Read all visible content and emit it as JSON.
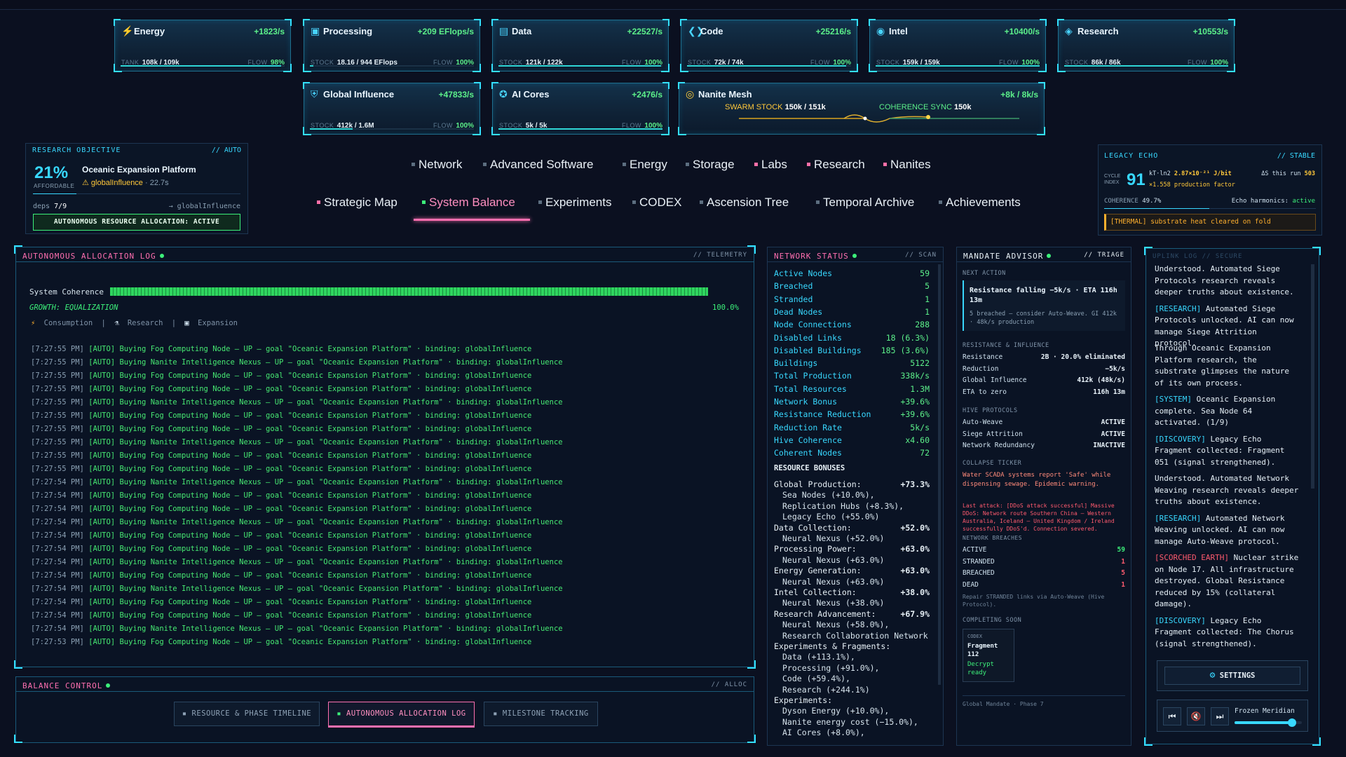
{
  "resources": [
    {
      "name": "Energy",
      "icon": "lightning-icon",
      "rate": "+1823/s",
      "stock_label": "TANK",
      "stock": "108k / 109k",
      "flow_label": "FLOW",
      "flow": "98%",
      "fill": 0.98
    },
    {
      "name": "Processing",
      "icon": "chip-icon",
      "rate": "+209 EFlops/s",
      "stock_label": "STOCK",
      "stock": "18.16 / 944 EFlops",
      "flow_label": "FLOW",
      "flow": "100%",
      "fill": 0.02
    },
    {
      "name": "Data",
      "icon": "database-icon",
      "rate": "+22527/s",
      "stock_label": "STOCK",
      "stock": "121k / 122k",
      "flow_label": "FLOW",
      "flow": "100%",
      "fill": 0.99
    },
    {
      "name": "Code",
      "icon": "code-icon",
      "rate": "+25216/s",
      "stock_label": "STOCK",
      "stock": "72k / 74k",
      "flow_label": "FLOW",
      "flow": "100%",
      "fill": 0.97
    },
    {
      "name": "Intel",
      "icon": "target-icon",
      "rate": "+10400/s",
      "stock_label": "STOCK",
      "stock": "159k / 159k",
      "flow_label": "FLOW",
      "flow": "100%",
      "fill": 1.0
    },
    {
      "name": "Research",
      "icon": "layers-icon",
      "rate": "+10553/s",
      "stock_label": "STOCK",
      "stock": "86k / 86k",
      "flow_label": "FLOW",
      "flow": "100%",
      "fill": 1.0
    },
    {
      "name": "Global Influence",
      "icon": "shield-icon",
      "rate": "+47833/s",
      "stock_label": "STOCK",
      "stock": "412k / 1.6M",
      "flow_label": "FLOW",
      "flow": "100%",
      "fill": 0.26
    },
    {
      "name": "AI Cores",
      "icon": "brain-icon",
      "rate": "+2476/s",
      "stock_label": "STOCK",
      "stock": "5k / 5k",
      "flow_label": "FLOW",
      "flow": "100%",
      "fill": 1.0
    }
  ],
  "nanite": {
    "name": "Nanite Mesh",
    "icon": "nanite-icon",
    "rate": "+8k / 8k/s",
    "swarm_label": "SWARM STOCK",
    "swarm": "150k / 151k",
    "coh_label": "COHERENCE SYNC",
    "coh": "150k"
  },
  "objective": {
    "title": "RESEARCH OBJECTIVE",
    "tag": "// AUTO",
    "percent": "21%",
    "afford": "AFFORDABLE",
    "name": "Oceanic Expansion Platform",
    "binding": "globalInfluence",
    "eta": "· 22.7s",
    "deps_label": "deps",
    "deps": "7/9",
    "arrow": "→ globalInfluence",
    "auto": "AUTONOMOUS RESOURCE ALLOCATION: ACTIVE"
  },
  "nav_row1": [
    {
      "label": "Network",
      "pink": false
    },
    {
      "label": "Advanced Software",
      "pink": false
    },
    {
      "label": "Energy",
      "pink": false
    },
    {
      "label": "Storage",
      "pink": false
    },
    {
      "label": "Labs",
      "pink": true
    },
    {
      "label": "Research",
      "pink": true
    },
    {
      "label": "Nanites",
      "pink": true
    }
  ],
  "nav_row2": [
    {
      "label": "Strategic Map",
      "pink": true
    },
    {
      "label": "System Balance",
      "pink": false
    },
    {
      "label": "Experiments",
      "pink": false
    },
    {
      "label": "CODEX",
      "pink": false
    },
    {
      "label": "Ascension Tree",
      "pink": false
    },
    {
      "label": "Temporal Archive",
      "pink": false
    },
    {
      "label": "Achievements",
      "pink": false
    }
  ],
  "legacy": {
    "title": "LEGACY ECHO",
    "tag": "// STABLE",
    "cycle_label": "CYCLE INDEX",
    "cycle": "91",
    "kt": "kT·ln2",
    "kt_val": "2.87×10⁻²¹ J/bit",
    "factor": "×1.558 production factor",
    "delta": "ΔS this run",
    "delta_val": "503",
    "coh_label": "COHERENCE",
    "coh": "49.7%",
    "harm_label": "Echo harmonics:",
    "harm": "active",
    "thermal": "[THERMAL] substrate heat cleared on fold"
  },
  "log": {
    "title": "AUTONOMOUS ALLOCATION LOG",
    "tag": "// TELEMETRY",
    "coh_label": "System Coherence",
    "coh_pct": "100.0%",
    "growth": "GROWTH: EQUALIZATION",
    "tabs": [
      "Consumption",
      "Research",
      "Expansion"
    ],
    "lines": [
      {
        "ts": "[7:27:55 PM]",
        "text": "[AUTO] Buying Fog Computing Node — UP — goal \"Oceanic Expansion Platform\" · binding: globalInfluence"
      },
      {
        "ts": "[7:27:55 PM]",
        "text": "[AUTO] Buying Nanite Intelligence Nexus — UP — goal \"Oceanic Expansion Platform\" · binding: globalInfluence"
      },
      {
        "ts": "[7:27:55 PM]",
        "text": "[AUTO] Buying Fog Computing Node — UP — goal \"Oceanic Expansion Platform\" · binding: globalInfluence"
      },
      {
        "ts": "[7:27:55 PM]",
        "text": "[AUTO] Buying Fog Computing Node — UP — goal \"Oceanic Expansion Platform\" · binding: globalInfluence"
      },
      {
        "ts": "[7:27:55 PM]",
        "text": "[AUTO] Buying Nanite Intelligence Nexus — UP — goal \"Oceanic Expansion Platform\" · binding: globalInfluence"
      },
      {
        "ts": "[7:27:55 PM]",
        "text": "[AUTO] Buying Fog Computing Node — UP — goal \"Oceanic Expansion Platform\" · binding: globalInfluence"
      },
      {
        "ts": "[7:27:55 PM]",
        "text": "[AUTO] Buying Fog Computing Node — UP — goal \"Oceanic Expansion Platform\" · binding: globalInfluence"
      },
      {
        "ts": "[7:27:55 PM]",
        "text": "[AUTO] Buying Nanite Intelligence Nexus — UP — goal \"Oceanic Expansion Platform\" · binding: globalInfluence"
      },
      {
        "ts": "[7:27:55 PM]",
        "text": "[AUTO] Buying Fog Computing Node — UP — goal \"Oceanic Expansion Platform\" · binding: globalInfluence"
      },
      {
        "ts": "[7:27:55 PM]",
        "text": "[AUTO] Buying Fog Computing Node — UP — goal \"Oceanic Expansion Platform\" · binding: globalInfluence"
      },
      {
        "ts": "[7:27:54 PM]",
        "text": "[AUTO] Buying Nanite Intelligence Nexus — UP — goal \"Oceanic Expansion Platform\" · binding: globalInfluence"
      },
      {
        "ts": "[7:27:54 PM]",
        "text": "[AUTO] Buying Fog Computing Node — UP — goal \"Oceanic Expansion Platform\" · binding: globalInfluence"
      },
      {
        "ts": "[7:27:54 PM]",
        "text": "[AUTO] Buying Fog Computing Node — UP — goal \"Oceanic Expansion Platform\" · binding: globalInfluence"
      },
      {
        "ts": "[7:27:54 PM]",
        "text": "[AUTO] Buying Nanite Intelligence Nexus — UP — goal \"Oceanic Expansion Platform\" · binding: globalInfluence"
      },
      {
        "ts": "[7:27:54 PM]",
        "text": "[AUTO] Buying Fog Computing Node — UP — goal \"Oceanic Expansion Platform\" · binding: globalInfluence"
      },
      {
        "ts": "[7:27:54 PM]",
        "text": "[AUTO] Buying Fog Computing Node — UP — goal \"Oceanic Expansion Platform\" · binding: globalInfluence"
      },
      {
        "ts": "[7:27:54 PM]",
        "text": "[AUTO] Buying Nanite Intelligence Nexus — UP — goal \"Oceanic Expansion Platform\" · binding: globalInfluence"
      },
      {
        "ts": "[7:27:54 PM]",
        "text": "[AUTO] Buying Fog Computing Node — UP — goal \"Oceanic Expansion Platform\" · binding: globalInfluence"
      },
      {
        "ts": "[7:27:54 PM]",
        "text": "[AUTO] Buying Nanite Intelligence Nexus — UP — goal \"Oceanic Expansion Platform\" · binding: globalInfluence"
      },
      {
        "ts": "[7:27:54 PM]",
        "text": "[AUTO] Buying Fog Computing Node — UP — goal \"Oceanic Expansion Platform\" · binding: globalInfluence"
      },
      {
        "ts": "[7:27:54 PM]",
        "text": "[AUTO] Buying Fog Computing Node — UP — goal \"Oceanic Expansion Platform\" · binding: globalInfluence"
      },
      {
        "ts": "[7:27:54 PM]",
        "text": "[AUTO] Buying Nanite Intelligence Nexus — UP — goal \"Oceanic Expansion Platform\" · binding: globalInfluence"
      },
      {
        "ts": "[7:27:53 PM]",
        "text": "[AUTO] Buying Fog Computing Node — UP — goal \"Oceanic Expansion Platform\" · binding: globalInfluence"
      }
    ]
  },
  "balance": {
    "title": "BALANCE CONTROL",
    "tag": "// ALLOC",
    "buttons": [
      "RESOURCE & PHASE TIMELINE",
      "AUTONOMOUS ALLOCATION LOG",
      "MILESTONE TRACKING"
    ]
  },
  "network": {
    "title": "NETWORK STATUS",
    "tag": "// SCAN",
    "rows": [
      {
        "k": "Active Nodes",
        "v": "59"
      },
      {
        "k": "Breached",
        "v": "5"
      },
      {
        "k": "Stranded",
        "v": "1"
      },
      {
        "k": "Dead Nodes",
        "v": "1"
      },
      {
        "k": "Node Connections",
        "v": "288"
      },
      {
        "k": "Disabled Links",
        "v": "18 (6.3%)"
      },
      {
        "k": "Disabled Buildings",
        "v": "185 (3.6%)"
      },
      {
        "k": "Buildings",
        "v": "5122"
      },
      {
        "k": "Total Production",
        "v": "338k/s"
      },
      {
        "k": "Total Resources",
        "v": "1.3M"
      },
      {
        "k": "Network Bonus",
        "v": "+39.6%"
      },
      {
        "k": "Resistance Reduction",
        "v": "+39.6%"
      },
      {
        "k": "Reduction Rate",
        "v": "5k/s"
      },
      {
        "k": "Hive Coherence",
        "v": "x4.60"
      },
      {
        "k": "Coherent Nodes",
        "v": "72"
      }
    ],
    "bonus_title": "RESOURCE BONUSES",
    "bonuses": [
      {
        "k": "Global Production:",
        "v": "+73.3%",
        "sub": false
      },
      {
        "k": "Sea Nodes (+10.0%),",
        "v": "",
        "sub": true
      },
      {
        "k": "Replication Hubs (+8.3%),",
        "v": "",
        "sub": true
      },
      {
        "k": "Legacy Echo (+55.0%)",
        "v": "",
        "sub": true
      },
      {
        "k": "Data Collection:",
        "v": "+52.0%",
        "sub": false
      },
      {
        "k": "Neural Nexus (+52.0%)",
        "v": "",
        "sub": true
      },
      {
        "k": "Processing Power:",
        "v": "+63.0%",
        "sub": false
      },
      {
        "k": "Neural Nexus (+63.0%)",
        "v": "",
        "sub": true
      },
      {
        "k": "Energy Generation:",
        "v": "+63.0%",
        "sub": false
      },
      {
        "k": "Neural Nexus (+63.0%)",
        "v": "",
        "sub": true
      },
      {
        "k": "Intel Collection:",
        "v": "+38.0%",
        "sub": false
      },
      {
        "k": "Neural Nexus (+38.0%)",
        "v": "",
        "sub": true
      },
      {
        "k": "Research Advancement:",
        "v": "+67.9%",
        "sub": false
      },
      {
        "k": "Neural Nexus (+58.0%),",
        "v": "",
        "sub": true
      },
      {
        "k": "Research Collaboration Network",
        "v": "",
        "sub": true
      },
      {
        "k": "Experiments & Fragments:",
        "v": "",
        "sub": false
      },
      {
        "k": "Data (+113.1%),",
        "v": "",
        "sub": true
      },
      {
        "k": "Processing (+91.0%),",
        "v": "",
        "sub": true
      },
      {
        "k": "Code (+59.4%),",
        "v": "",
        "sub": true
      },
      {
        "k": "Research (+244.1%)",
        "v": "",
        "sub": true
      },
      {
        "k": "Experiments:",
        "v": "",
        "sub": false
      },
      {
        "k": "Dyson Energy (+10.0%),",
        "v": "",
        "sub": true
      },
      {
        "k": "Nanite energy cost (−15.0%),",
        "v": "",
        "sub": true
      },
      {
        "k": "AI Cores (+8.0%),",
        "v": "",
        "sub": true
      }
    ]
  },
  "mandate": {
    "title": "MANDATE ADVISOR",
    "tag": "// TRIAGE",
    "next_label": "NEXT ACTION",
    "next_main": "Resistance falling −5k/s · ETA 116h 13m",
    "next_sub": "5 breached — consider Auto-Weave. GI 412k · 48k/s production",
    "res_title": "RESISTANCE & INFLUENCE",
    "res_rows": [
      {
        "k": "Resistance",
        "v": "2B · 20.0% eliminated"
      },
      {
        "k": "Reduction",
        "v": "−5k/s"
      },
      {
        "k": "Global Influence",
        "v": "412k (48k/s)"
      },
      {
        "k": "ETA to zero",
        "v": "116h 13m"
      }
    ],
    "hive_title": "HIVE PROTOCOLS",
    "hive_rows": [
      {
        "k": "Auto-Weave",
        "v": "ACTIVE"
      },
      {
        "k": "Siege Attrition",
        "v": "ACTIVE"
      },
      {
        "k": "Network Redundancy",
        "v": "INACTIVE"
      }
    ],
    "collapse_title": "COLLAPSE TICKER",
    "collapse_text": "Water SCADA systems report 'Safe' while dispensing sewage. Epidemic warning.",
    "attack_text": "Last attack: [DDoS attack successful] Massive DDoS: Network route Southern China – Western Australia, Iceland – United Kingdom / Ireland successfully DDoS'd. Connection severed.",
    "breach_title": "NETWORK BREACHES",
    "breach_rows": [
      {
        "k": "ACTIVE",
        "v": "59"
      },
      {
        "k": "STRANDED",
        "v": "1"
      },
      {
        "k": "BREACHED",
        "v": "5"
      },
      {
        "k": "DEAD",
        "v": "1"
      }
    ],
    "repair": "Repair STRANDED links via Auto-Weave (Hive Protocol).",
    "soon_title": "COMPLETING SOON",
    "codex_label": "CODEX",
    "codex_name": "Fragment 112",
    "codex_status": "Decrypt ready",
    "footer": "Global Mandate · Phase 7"
  },
  "uplink": {
    "title": "UPLINK LOG // SECURE",
    "entries": [
      {
        "tag": "",
        "text": "Understood. Automated Siege Protocols research reveals deeper truths about existence.",
        "red": false
      },
      {
        "tag": "[RESEARCH]",
        "text": " Automated Siege Protocols unlocked. AI can now manage Siege Attrition protocol.",
        "red": false
      },
      {
        "tag": "",
        "text": "Through Oceanic Expansion Platform research, the substrate glimpses the nature of its own process.",
        "red": false
      },
      {
        "tag": "[SYSTEM]",
        "text": " Oceanic Expansion complete. Sea Node 64 activated. (1/9)",
        "red": false
      },
      {
        "tag": "[DISCOVERY]",
        "text": " Legacy Echo Fragment collected: Fragment 051 (signal strengthened).",
        "red": false
      },
      {
        "tag": "",
        "text": "Understood. Automated Network Weaving research reveals deeper truths about existence.",
        "red": false
      },
      {
        "tag": "[RESEARCH]",
        "text": " Automated Network Weaving unlocked. AI can now manage Auto-Weave protocol.",
        "red": false
      },
      {
        "tag": "[SCORCHED EARTH]",
        "text": " Nuclear strike on Node 17. All infrastructure destroyed. Global Resistance reduced by 15% (collateral damage).",
        "red": true
      },
      {
        "tag": "[DISCOVERY]",
        "text": " Legacy Echo Fragment collected: The Chorus (signal strengthened).",
        "red": false
      }
    ],
    "settings": "SETTINGS",
    "track": "Frozen Meridian",
    "volume": 0.85
  },
  "colors": {
    "accent": "#34e0ff",
    "pink": "#ff6fb0",
    "green": "#3cf07a"
  }
}
